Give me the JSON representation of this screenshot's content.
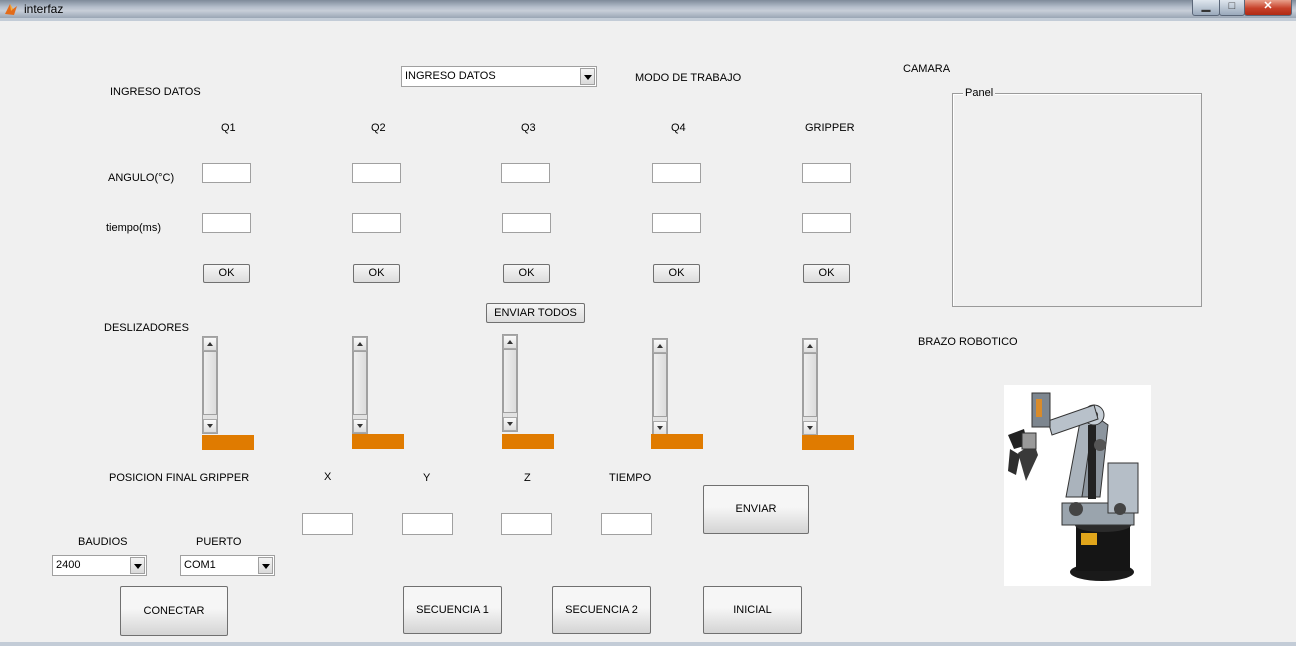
{
  "window": {
    "title": "interfaz"
  },
  "window_buttons": {
    "minimize": "▁",
    "maximize": "□",
    "close": "✕"
  },
  "mode_popup": {
    "selected": "INGRESO DATOS"
  },
  "labels": {
    "mode": "MODO DE TRABAJO",
    "ingreso": "INGRESO DATOS",
    "camera": "CAMARA",
    "angle": "ANGULO(°C)",
    "time": "tiempo(ms)",
    "sliders": "DESLIZADORES",
    "robot": "BRAZO ROBOTICO",
    "final_position": "POSICION FINAL GRIPPER",
    "baud": "BAUDIOS",
    "port": "PUERTO"
  },
  "joints": [
    {
      "name": "Q1",
      "ok": "OK"
    },
    {
      "name": "Q2",
      "ok": "OK"
    },
    {
      "name": "Q3",
      "ok": "OK"
    },
    {
      "name": "Q4",
      "ok": "OK"
    },
    {
      "name": "GRIPPER",
      "ok": "OK"
    }
  ],
  "send_all": "ENVIAR TODOS",
  "camera_panel": {
    "title": "Panel"
  },
  "position_fields": {
    "x": "X",
    "y": "Y",
    "z": "Z",
    "time": "TIEMPO"
  },
  "buttons": {
    "enviar": "ENVIAR",
    "conectar": "CONECTAR",
    "secuencia1": "SECUENCIA 1",
    "secuencia2": "SECUENCIA 2",
    "inicial": "INICIAL"
  },
  "baud_popup": {
    "selected": "2400"
  },
  "port_popup": {
    "selected": "COM1"
  },
  "colors": {
    "slider_indicator": "#e07b00"
  }
}
